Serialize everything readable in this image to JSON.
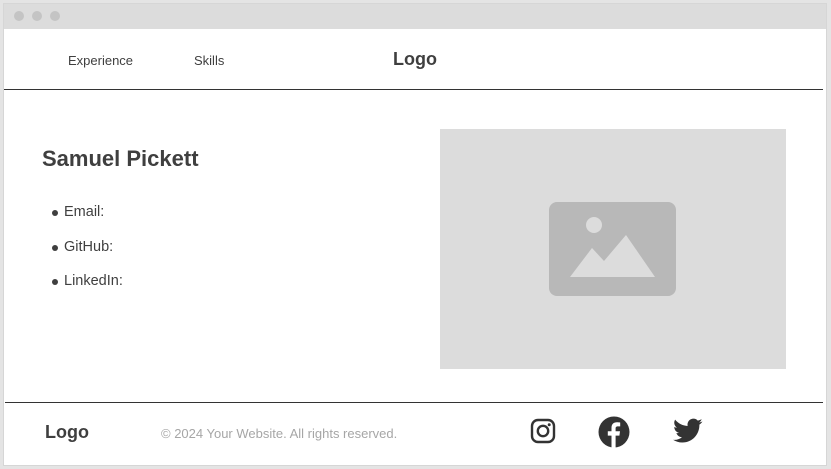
{
  "window": {
    "controls": [
      "close",
      "minimize",
      "maximize"
    ]
  },
  "header": {
    "nav": [
      {
        "label": "Experience"
      },
      {
        "label": "Skills"
      }
    ],
    "logo": "Logo"
  },
  "profile": {
    "name": "Samuel Pickett",
    "contacts": [
      {
        "label": "Email:"
      },
      {
        "label": "GitHub:"
      },
      {
        "label": "LinkedIn:"
      }
    ]
  },
  "image": {
    "icon": "image-placeholder-icon"
  },
  "footer": {
    "logo": "Logo",
    "copyright": "© 2024 Your Website. All rights reserved.",
    "social": [
      {
        "icon": "instagram-icon"
      },
      {
        "icon": "facebook-icon"
      },
      {
        "icon": "twitter-icon"
      }
    ]
  },
  "colors": {
    "text": "#3f3f3f",
    "muted": "#a6a6a6",
    "placeholder_bg": "#dcdcdc",
    "placeholder_icon": "#b8b8b8",
    "titlebar": "#dcdcdc"
  }
}
